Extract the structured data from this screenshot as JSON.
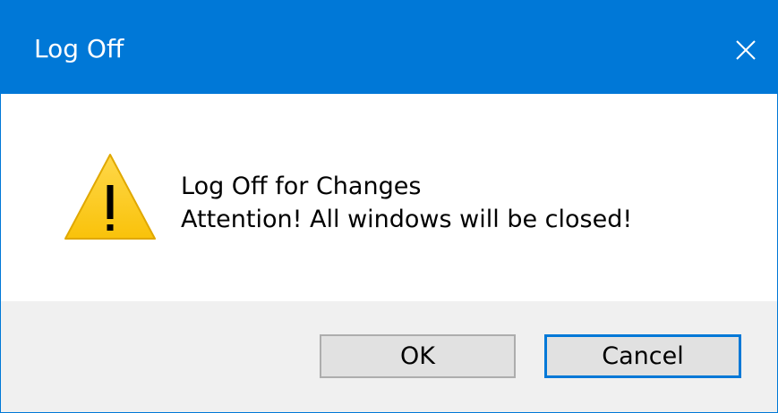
{
  "window": {
    "title": "Log Off",
    "accent_color": "#0078d7",
    "close_icon": "close-icon"
  },
  "message": {
    "icon": "warning-icon",
    "line1": "Log Off for Changes",
    "line2": "Attention! All windows will be closed!"
  },
  "buttons": {
    "ok_label": "OK",
    "cancel_label": "Cancel"
  }
}
